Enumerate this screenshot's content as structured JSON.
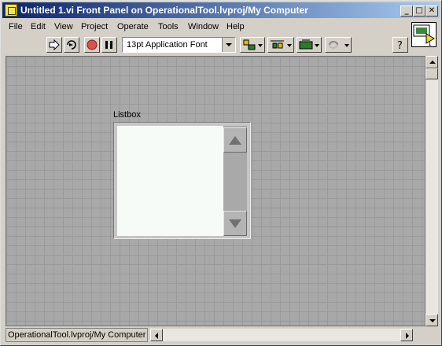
{
  "window": {
    "title": "Untitled 1.vi Front Panel on OperationalTool.lvproj/My Computer",
    "controls": {
      "minimize": "_",
      "maximize": "□",
      "close": "✕"
    }
  },
  "menubar": {
    "items": [
      {
        "label": "File"
      },
      {
        "label": "Edit"
      },
      {
        "label": "View"
      },
      {
        "label": "Project"
      },
      {
        "label": "Operate"
      },
      {
        "label": "Tools"
      },
      {
        "label": "Window"
      },
      {
        "label": "Help"
      }
    ]
  },
  "toolbar": {
    "font_select": "13pt Application Font",
    "buttons": [
      "run-arrow-icon",
      "run-continuously-icon",
      "abort-icon",
      "pause-icon",
      "align-icon",
      "distribute-icon",
      "resize-icon",
      "reorder-icon",
      "help-icon"
    ]
  },
  "front_panel": {
    "listbox": {
      "label": "Listbox"
    }
  },
  "statusbar": {
    "context": "OperationalTool.lvproj/My Computer"
  },
  "colors": {
    "titlebar_start": "#0a246a",
    "titlebar_end": "#a6caf0",
    "panel_bg": "#a8a8a8",
    "grid_line": "#9a9a9a",
    "listbox_bg": "#f7fbf8"
  }
}
